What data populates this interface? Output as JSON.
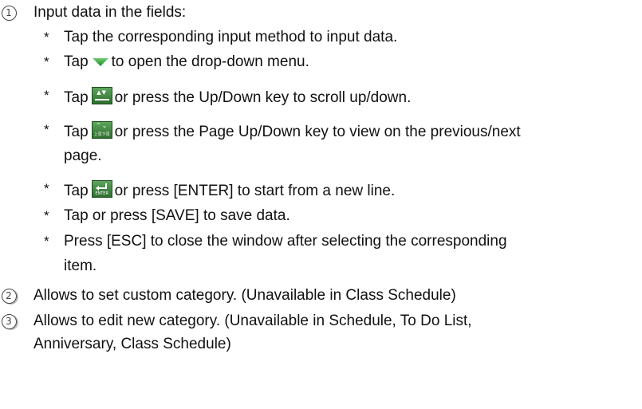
{
  "items": {
    "item1": {
      "number": "1",
      "text": "Input data in the fields:"
    },
    "sub1": {
      "star": "*",
      "text": "Tap the corresponding input method to input data."
    },
    "sub2": {
      "star": "*",
      "pre": "Tap",
      "post": "to open the drop-down menu.",
      "icon": "green-dropdown-arrow-icon"
    },
    "sub3": {
      "star": "*",
      "pre": "Tap",
      "post": "or press the Up/Down key to scroll up/down.",
      "icon": "up-down-scroll-icon"
    },
    "sub4": {
      "star": "*",
      "pre": "Tap",
      "post": "or press the Page Up/Down key to view on the previous/next",
      "cont": "page.",
      "icon": "page-up-down-icon",
      "icon_text": "上頁下頁"
    },
    "sub5": {
      "star": "*",
      "pre": "Tap",
      "post": "or press [ENTER] to start from a new line.",
      "icon": "enter-icon",
      "icon_text": "ENTER"
    },
    "sub6": {
      "star": "*",
      "text": "Tap or press [SAVE] to save data."
    },
    "sub7": {
      "star": "*",
      "text": "Press [ESC] to close the window after selecting the corresponding",
      "cont": "item."
    },
    "item2": {
      "number": "2",
      "text": "Allows to set custom category. (Unavailable in Class Schedule)"
    },
    "item3": {
      "number": "3",
      "text": "Allows to edit new category. (Unavailable in Schedule, To Do List,",
      "cont": "Anniversary, Class Schedule)"
    }
  },
  "colors": {
    "icon_green_top": "#5da55d",
    "icon_green_bottom": "#2d6e2f",
    "dropdown_green": "#2e9e3a"
  }
}
